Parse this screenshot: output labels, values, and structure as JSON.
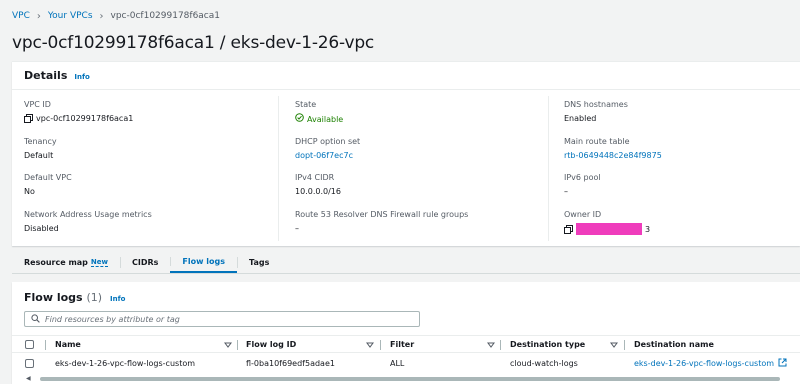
{
  "breadcrumb": {
    "items": [
      "VPC",
      "Your VPCs",
      "vpc-0cf10299178f6aca1"
    ]
  },
  "page_title": "vpc-0cf10299178f6aca1 / eks-dev-1-26-vpc",
  "details": {
    "title": "Details",
    "info": "Info",
    "fields": {
      "vpc_id": {
        "label": "VPC ID",
        "value": "vpc-0cf10299178f6aca1"
      },
      "tenancy": {
        "label": "Tenancy",
        "value": "Default"
      },
      "default_vpc": {
        "label": "Default VPC",
        "value": "No"
      },
      "network_address_usage": {
        "label": "Network Address Usage metrics",
        "value": "Disabled"
      },
      "state": {
        "label": "State",
        "value": "Available"
      },
      "dhcp": {
        "label": "DHCP option set",
        "value": "dopt-06f7ec7c"
      },
      "ipv4": {
        "label": "IPv4 CIDR",
        "value": "10.0.0.0/16"
      },
      "route53": {
        "label": "Route 53 Resolver DNS Firewall rule groups",
        "value": "–"
      },
      "dns_hostnames": {
        "label": "DNS hostnames",
        "value": "Enabled"
      },
      "main_route_table": {
        "label": "Main route table",
        "value": "rtb-0649448c2e84f9875"
      },
      "ipv6_pool": {
        "label": "IPv6 pool",
        "value": "–"
      },
      "owner_id": {
        "label": "Owner ID",
        "value_suffix": "3"
      }
    }
  },
  "tabs": [
    {
      "label": "Resource map",
      "badge": "New"
    },
    {
      "label": "CIDRs"
    },
    {
      "label": "Flow logs",
      "active": true
    },
    {
      "label": "Tags"
    }
  ],
  "flow_logs": {
    "title": "Flow logs",
    "count": "(1)",
    "info": "Info",
    "search_placeholder": "Find resources by attribute or tag",
    "columns": [
      "Name",
      "Flow log ID",
      "Filter",
      "Destination type",
      "Destination name"
    ],
    "rows": [
      {
        "name": "eks-dev-1-26-vpc-flow-logs-custom",
        "flow_log_id": "fl-0ba10f69edf5adae1",
        "filter": "ALL",
        "destination_type": "cloud-watch-logs",
        "destination_name": "eks-dev-1-26-vpc-flow-logs-custom"
      }
    ]
  },
  "colors": {
    "link": "#0073bb",
    "success": "#1d8102",
    "redaction": "#ef3cbc"
  }
}
